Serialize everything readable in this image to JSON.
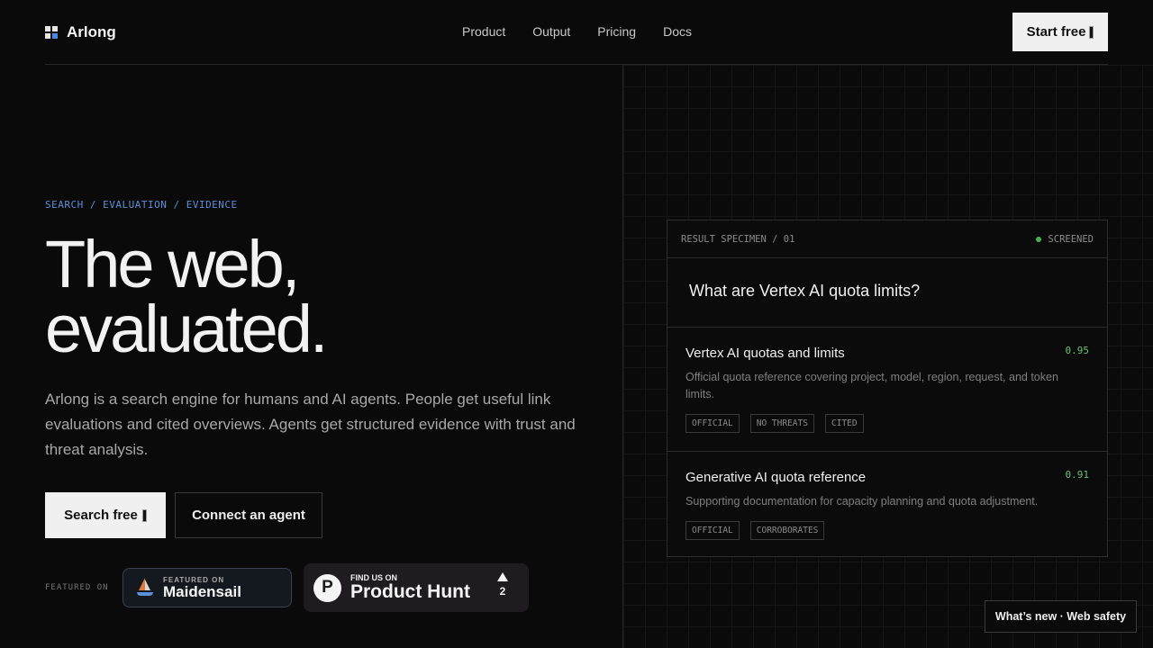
{
  "header": {
    "brand": "Arlong",
    "nav": [
      "Product",
      "Output",
      "Pricing",
      "Docs"
    ],
    "cta": "Start free"
  },
  "hero": {
    "breadcrumb": "SEARCH / EVALUATION / EVIDENCE",
    "title_line1": "The web,",
    "title_line2": "evaluated.",
    "description": "Arlong is a search engine for humans and AI agents. People get useful link evaluations and cited overviews. Agents get structured evidence with trust and threat analysis.",
    "primary_button": "Search free",
    "secondary_button": "Connect an agent",
    "featured_label": "FEATURED ON",
    "maidensail": {
      "small": "FEATURED ON",
      "name": "Maidensail"
    },
    "producthunt": {
      "small": "FIND US ON",
      "name": "Product Hunt",
      "votes": "2",
      "logo_letter": "P"
    }
  },
  "specimen": {
    "label": "RESULT SPECIMEN / 01",
    "status": "SCREENED",
    "query": "What are Vertex AI quota limits?",
    "results": [
      {
        "title": "Vertex AI quotas and limits",
        "score": "0.95",
        "description": "Official quota reference covering project, model, region, request, and token limits.",
        "tags": [
          "OFFICIAL",
          "NO THREATS",
          "CITED"
        ]
      },
      {
        "title": "Generative AI quota reference",
        "score": "0.91",
        "description": "Supporting documentation for capacity planning and quota adjustment.",
        "tags": [
          "OFFICIAL",
          "CORROBORATES"
        ]
      }
    ]
  },
  "footer_pill": "What’s new · Web safety",
  "colors": {
    "background": "#0a0a0a",
    "accent_blue": "#5b8fd6",
    "score_green": "#6cc070",
    "status_green": "#4caf50"
  },
  "icons": [
    "logo-grid-icon",
    "cursor-icon",
    "sailboat-icon",
    "product-hunt-icon",
    "upvote-arrow-icon",
    "status-dot-icon"
  ]
}
